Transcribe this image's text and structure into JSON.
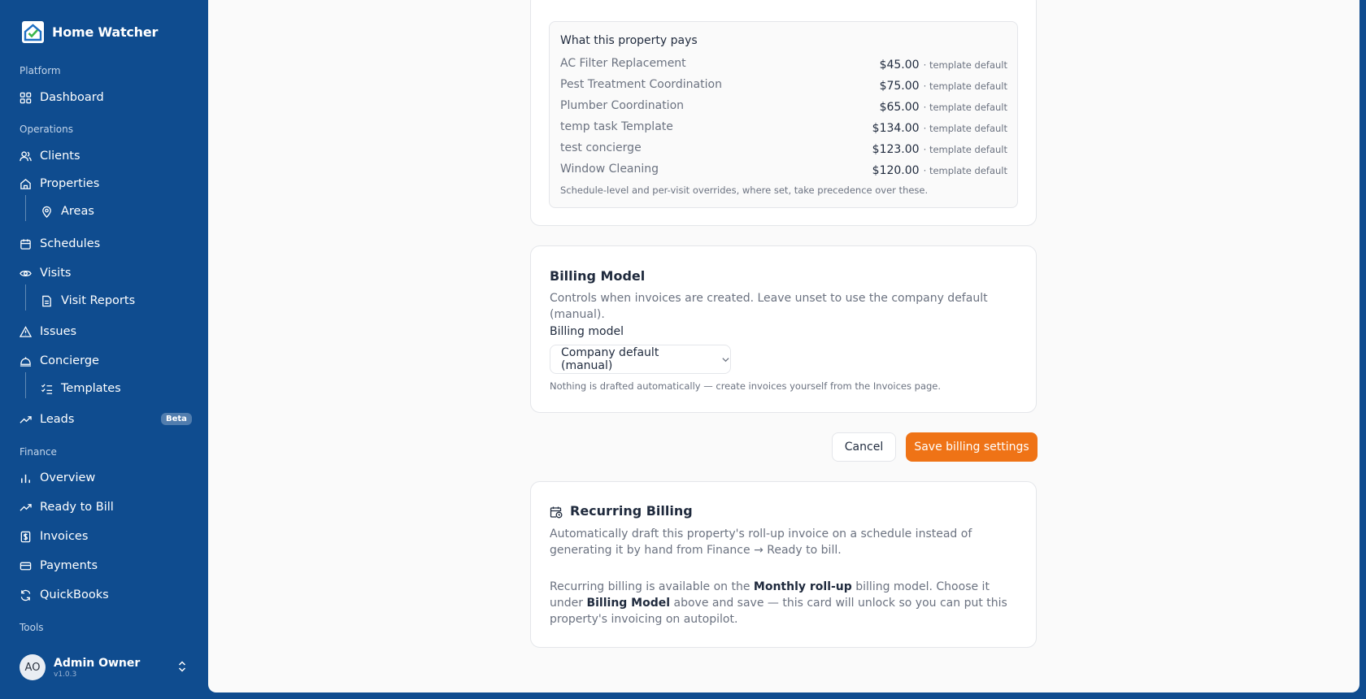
{
  "brand": {
    "name": "Home Watcher"
  },
  "sidebar": {
    "sections": {
      "platform": "Platform",
      "operations": "Operations",
      "finance": "Finance",
      "tools": "Tools"
    },
    "items": {
      "dashboard": "Dashboard",
      "clients": "Clients",
      "properties": "Properties",
      "areas": "Areas",
      "schedules": "Schedules",
      "visits": "Visits",
      "visit_reports": "Visit Reports",
      "issues": "Issues",
      "concierge": "Concierge",
      "templates": "Templates",
      "leads": "Leads",
      "leads_badge": "Beta",
      "overview": "Overview",
      "ready_to_bill": "Ready to Bill",
      "invoices": "Invoices",
      "payments": "Payments",
      "quickbooks": "QuickBooks"
    },
    "user": {
      "initials": "AO",
      "name": "Admin Owner",
      "version": "v1.0.3"
    }
  },
  "pays": {
    "title": "What this property pays",
    "rows": [
      {
        "name": "AC Filter Replacement",
        "price": "$45.00",
        "note": "· template default"
      },
      {
        "name": "Pest Treatment Coordination",
        "price": "$75.00",
        "note": "· template default"
      },
      {
        "name": "Plumber Coordination",
        "price": "$65.00",
        "note": "· template default"
      },
      {
        "name": "temp task Template",
        "price": "$134.00",
        "note": "· template default"
      },
      {
        "name": "test concierge",
        "price": "$123.00",
        "note": "· template default"
      },
      {
        "name": "Window Cleaning",
        "price": "$120.00",
        "note": "· template default"
      }
    ],
    "footnote": "Schedule-level and per-visit overrides, where set, take precedence over these."
  },
  "billing_model": {
    "title": "Billing Model",
    "description": "Controls when invoices are created. Leave unset to use the company default (manual).",
    "field_label": "Billing model",
    "selected": "Company default (manual)",
    "hint": "Nothing is drafted automatically — create invoices yourself from the Invoices page."
  },
  "actions": {
    "cancel": "Cancel",
    "save": "Save billing settings"
  },
  "recurring": {
    "title": "Recurring Billing",
    "description": "Automatically draft this property's roll-up invoice on a schedule instead of generating it by hand from Finance → Ready to bill.",
    "info_prefix": "Recurring billing is available on the ",
    "info_bold1": "Monthly roll-up",
    "info_mid": " billing model. Choose it under ",
    "info_bold2": "Billing Model",
    "info_suffix": " above and save — this card will unlock so you can put this property's invoicing on autopilot."
  },
  "colors": {
    "sidebar": "#0f4c8f",
    "accent": "#ef7316",
    "background": "#fafafa"
  }
}
